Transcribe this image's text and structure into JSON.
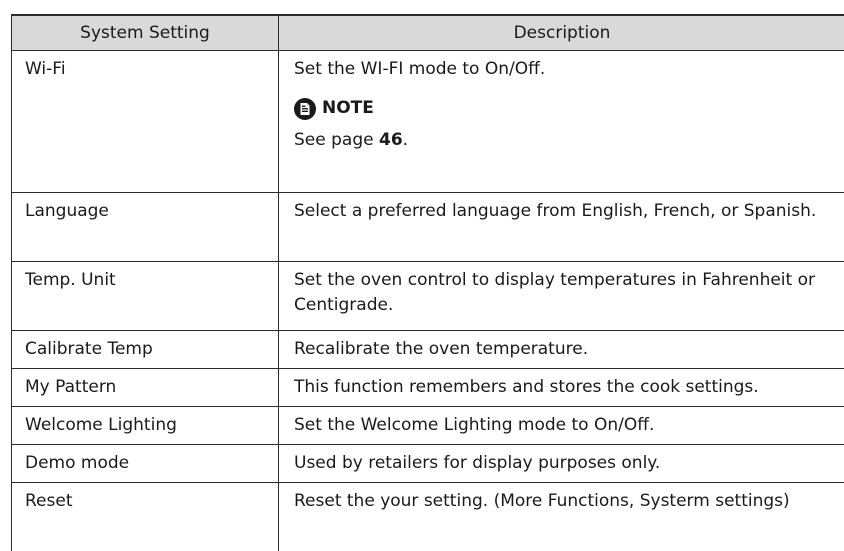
{
  "table": {
    "headers": {
      "setting": "System Setting",
      "description": "Description"
    },
    "rows": [
      {
        "setting": "Wi-Fi",
        "description": "Set the WI-FI mode to On/Off.",
        "note": {
          "label": "NOTE",
          "text_before": "See page ",
          "page": "46",
          "text_after": "."
        }
      },
      {
        "setting": "Language",
        "description": "Select a preferred language from English, French, or Spanish."
      },
      {
        "setting": "Temp. Unit",
        "description": "Set the oven control to display temperatures in Fahrenheit or Centigrade."
      },
      {
        "setting": "Calibrate Temp",
        "description": "Recalibrate the oven temperature."
      },
      {
        "setting": "My Pattern",
        "description": "This function remembers and stores the cook settings."
      },
      {
        "setting": "Welcome Lighting",
        "description": "Set the Welcome Lighting mode to On/Off."
      },
      {
        "setting": "Demo mode",
        "description": "Used by retailers for display purposes only."
      },
      {
        "setting": "Reset",
        "description": "Reset the your setting. (More Functions, Systerm settings)"
      }
    ]
  },
  "colors": {
    "header_bg": "#d9d9d9",
    "border": "#2b2b2b",
    "text": "#1a1a1a"
  },
  "icons": {
    "note": "note-document-icon"
  }
}
